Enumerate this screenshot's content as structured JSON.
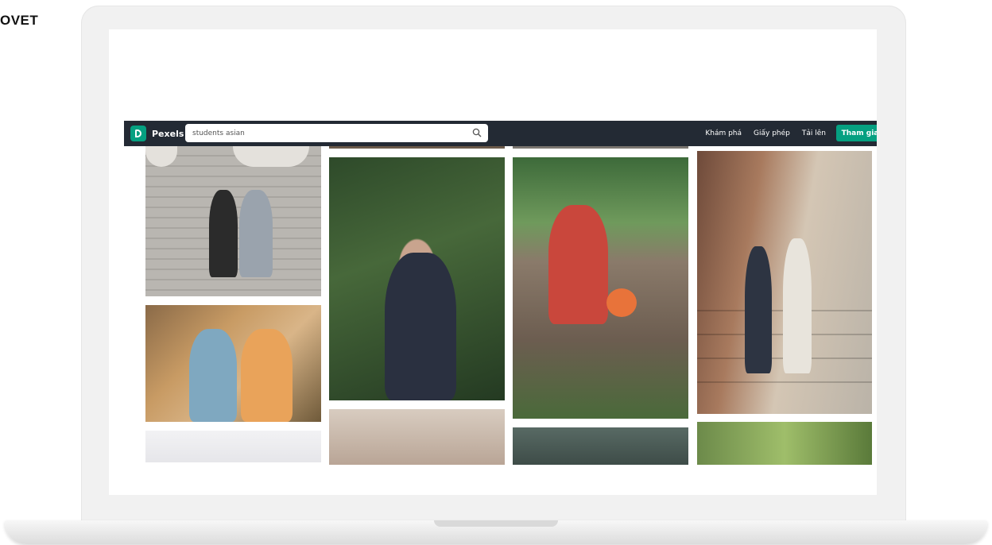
{
  "brand_tag": "OVET",
  "navbar": {
    "logo_text": "Pexels",
    "search": {
      "value": "students asian",
      "placeholder": ""
    },
    "links": [
      "Khám phá",
      "Giấy phép",
      "Tải lên"
    ],
    "more_label": "···",
    "join_label": "Tham gia"
  },
  "colors": {
    "nav_bg": "#232a34",
    "accent": "#05a081"
  },
  "icons": [
    "pexels-logo-icon",
    "search-icon",
    "more-icon"
  ]
}
